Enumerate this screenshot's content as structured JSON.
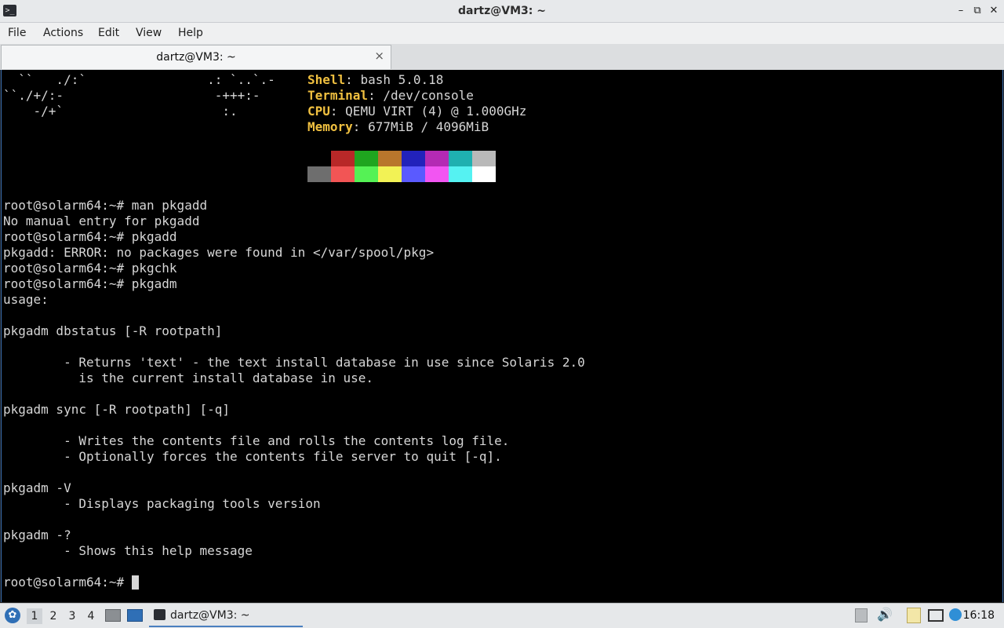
{
  "window": {
    "title": "dartz@VM3: ~"
  },
  "menu": {
    "file": "File",
    "actions": "Actions",
    "edit": "Edit",
    "view": "View",
    "help": "Help"
  },
  "tab": {
    "title": "dartz@VM3: ~",
    "close": "×"
  },
  "terminal": {
    "ascii": [
      "  ``   ./:`                .: `..`.-",
      "``./+/:-                    -+++:-",
      "    -/+`                     :.",
      "",
      "",
      "",
      "",
      "",
      "",
      "",
      "",
      "",
      "",
      "",
      "",
      "",
      "",
      "",
      "",
      "",
      "",
      "",
      "",
      "",
      "",
      "",
      "",
      "",
      "",
      "",
      "",
      "",
      "",
      "",
      "",
      "",
      "",
      "",
      "",
      ""
    ],
    "sysinfo": [
      {
        "key": "Shell",
        "value": ": bash 5.0.18"
      },
      {
        "key": "Terminal",
        "value": ": /dev/console"
      },
      {
        "key": "CPU",
        "value": ": QEMU VIRT (4) @ 1.000GHz"
      },
      {
        "key": "Memory",
        "value": ": 677MiB / 4096MiB"
      }
    ],
    "palette_top": [
      "#000000",
      "#b82828",
      "#1fa51f",
      "#b8762c",
      "#2222bb",
      "#b42ab4",
      "#1fb0b0",
      "#b9b9b9"
    ],
    "palette_bottom": [
      "#6e6e6e",
      "#f25555",
      "#55f255",
      "#f2f255",
      "#5a5aff",
      "#f255f2",
      "#55f2f2",
      "#ffffff"
    ],
    "lines": [
      "root@solarm64:~# man pkgadd",
      "No manual entry for pkgadd",
      "root@solarm64:~# pkgadd",
      "pkgadd: ERROR: no packages were found in </var/spool/pkg>",
      "root@solarm64:~# pkgchk",
      "root@solarm64:~# pkgadm",
      "usage:",
      "",
      "pkgadm dbstatus [-R rootpath]",
      "",
      "        - Returns 'text' - the text install database in use since Solaris 2.0",
      "          is the current install database in use.",
      "",
      "pkgadm sync [-R rootpath] [-q]",
      "",
      "        - Writes the contents file and rolls the contents log file.",
      "        - Optionally forces the contents file server to quit [-q].",
      "",
      "pkgadm -V",
      "        - Displays packaging tools version",
      "",
      "pkgadm -?",
      "        - Shows this help message",
      ""
    ],
    "prompt": "root@solarm64:~# "
  },
  "taskbar": {
    "desktops": [
      "1",
      "2",
      "3",
      "4"
    ],
    "task_label": "dartz@VM3: ~",
    "clock": "16:18"
  }
}
